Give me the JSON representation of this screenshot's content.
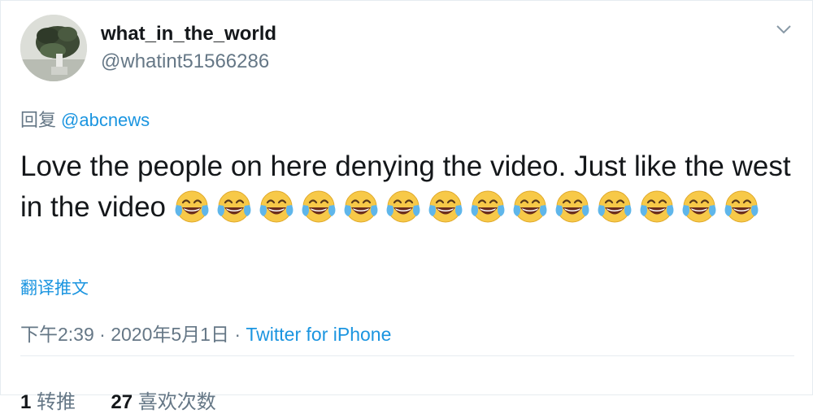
{
  "tweet": {
    "display_name": "what_in_the_world",
    "handle": "@whatint51566286",
    "reply_prefix": "回复",
    "reply_mention": "@abcnews",
    "text": "Love the people on here denying the video. Just like the west in the video",
    "emoji": "face-with-tears-of-joy",
    "emoji_count": 14,
    "translate_label": "翻译推文",
    "timestamp": "下午2:39 · 2020年5月1日",
    "separator": " · ",
    "source": "Twitter for iPhone"
  },
  "stats": {
    "retweets_count": "1",
    "retweets_label": "转推",
    "likes_count": "27",
    "likes_label": "喜欢次数"
  },
  "colors": {
    "link": "#1b95e0",
    "secondary": "#657786",
    "text": "#14171a"
  }
}
